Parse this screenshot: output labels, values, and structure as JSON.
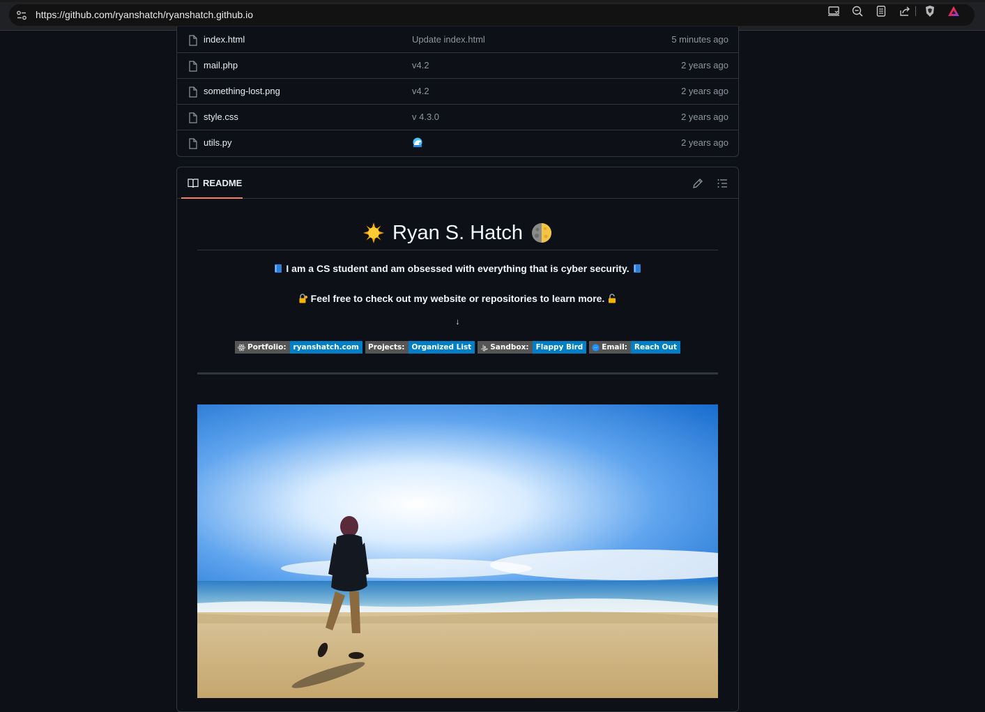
{
  "browser": {
    "url": "https://github.com/ryanshatch/ryanshatch.github.io",
    "icons": [
      "site-settings-icon",
      "cast-icon",
      "zoom-out-icon",
      "reader-mode-icon",
      "share-icon",
      "brave-shields-icon",
      "brave-rewards-icon"
    ]
  },
  "files": [
    {
      "name": "index.html",
      "commit": "Update index.html",
      "time": "5 minutes ago"
    },
    {
      "name": "mail.php",
      "commit": "v4.2",
      "time": "2 years ago"
    },
    {
      "name": "something-lost.png",
      "commit": "v4.2",
      "time": "2 years ago"
    },
    {
      "name": "style.css",
      "commit": "v 4.3.0",
      "time": "2 years ago"
    },
    {
      "name": "utils.py",
      "commit": "",
      "commit_icon": "wave-emoji",
      "time": "2 years ago"
    }
  ],
  "readme": {
    "tab_label": "README",
    "title": "Ryan S. Hatch",
    "line1": "I am a CS student and am obsessed with everything that is cyber security.",
    "line2": "Feel free to check out my website or repositories to learn more.",
    "arrow": "↓",
    "badges": [
      {
        "label": "Portfolio:",
        "value": "ryanshatch.com",
        "icon": "react-icon"
      },
      {
        "label": "Projects:",
        "value": "Organized List",
        "icon": ""
      },
      {
        "label": "Sandbox:",
        "value": "Flappy Bird",
        "icon": "playstation-icon"
      },
      {
        "label": "Email:",
        "value": "Reach Out",
        "icon": "messenger-icon"
      }
    ],
    "colors": {
      "badge_left": "#555555",
      "badge_right": "#007ec6",
      "tab_underline": "#f78166"
    }
  }
}
